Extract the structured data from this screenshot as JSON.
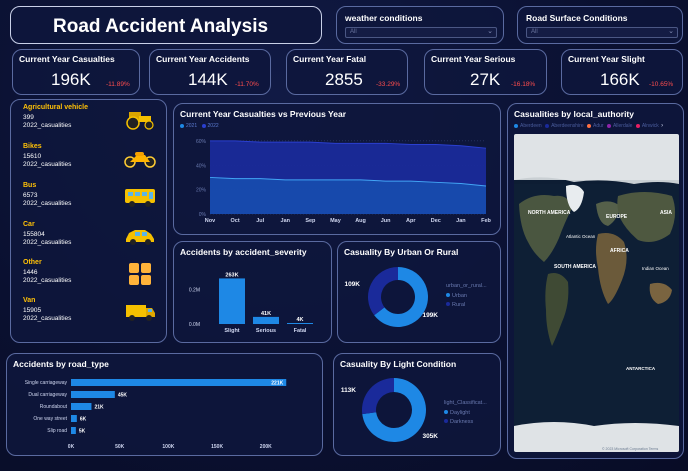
{
  "title": "Road Accident Analysis",
  "slicers": [
    {
      "label": "weather conditions",
      "value": "All"
    },
    {
      "label": "Road Surface Conditions",
      "value": "All"
    }
  ],
  "kpis": [
    {
      "label": "Current Year Casualties",
      "value": "196K",
      "change": "-11.89%"
    },
    {
      "label": "Current Year Accidents",
      "value": "144K",
      "change": "-11.70%"
    },
    {
      "label": "Current Year Fatal",
      "value": "2855",
      "change": "-33.29%"
    },
    {
      "label": "Current Year Serious",
      "value": "27K",
      "change": "-16.18%"
    },
    {
      "label": "Current Year Slight",
      "value": "166K",
      "change": "-10.65%"
    }
  ],
  "vehicles": [
    {
      "name": "Agricultural vehicle",
      "count": "399",
      "sub": "2022_casualities",
      "icon": "tractor-icon"
    },
    {
      "name": "Bikes",
      "count": "15610",
      "sub": "2022_casualities",
      "icon": "motorbike-icon"
    },
    {
      "name": "Bus",
      "count": "6573",
      "sub": "2022_casualities",
      "icon": "bus-icon"
    },
    {
      "name": "Car",
      "count": "155804",
      "sub": "2022_casualities",
      "icon": "car-icon"
    },
    {
      "name": "Other",
      "count": "1446",
      "sub": "2022_casualities",
      "icon": "grid-icon"
    },
    {
      "name": "Van",
      "count": "15905",
      "sub": "2022_casualities",
      "icon": "van-icon"
    }
  ],
  "colors": {
    "accent": "#1e88e5",
    "dark_series": "#1a2a9a",
    "negative": "#ff4d4d",
    "vehicle_label": "#ffc107"
  },
  "chart_data": [
    {
      "type": "area",
      "title": "Current Year Casualties vs Previous Year",
      "legend": [
        "2021",
        "2022"
      ],
      "x": [
        "Nov",
        "Oct",
        "Jul",
        "Jan",
        "Sep",
        "May",
        "Aug",
        "Jun",
        "Apr",
        "Dec",
        "Jan",
        "Feb"
      ],
      "y_ticks": [
        "0%",
        "20%",
        "40%",
        "60%"
      ],
      "ylim": [
        0,
        0.64
      ],
      "series": [
        {
          "name": "2021",
          "values": [
            0.6,
            0.6,
            0.59,
            0.59,
            0.59,
            0.58,
            0.58,
            0.58,
            0.57,
            0.57,
            0.56,
            0.54
          ]
        },
        {
          "name": "2022",
          "values": [
            0.3,
            0.29,
            0.29,
            0.28,
            0.28,
            0.28,
            0.28,
            0.27,
            0.27,
            0.26,
            0.25,
            0.23
          ]
        }
      ]
    },
    {
      "type": "bar",
      "title": "Accidents by accident_severity",
      "categories": [
        "Slight",
        "Serious",
        "Fatal"
      ],
      "values": [
        263000,
        41000,
        4000
      ],
      "data_labels": [
        "263K",
        "41K",
        "4K"
      ],
      "y_ticks": [
        "0.0M",
        "0.2M"
      ],
      "ylim": [
        0,
        300000
      ]
    },
    {
      "type": "pie",
      "title": "Casuality By Urban Or Rural",
      "legend_title": "urban_or_rural...",
      "categories": [
        "Urban",
        "Rural"
      ],
      "values": [
        199000,
        109000
      ],
      "data_labels": [
        "199K",
        "109K"
      ]
    },
    {
      "type": "bar",
      "title": "Accidents by road_type",
      "orientation": "horizontal",
      "categories": [
        "Single carriageway",
        "Dual carriageway",
        "Roundabout",
        "One way street",
        "Slip road"
      ],
      "values": [
        221000,
        45000,
        21000,
        6000,
        5000
      ],
      "data_labels": [
        "221K",
        "45K",
        "21K",
        "6K",
        "5K"
      ],
      "x_ticks": [
        "0K",
        "50K",
        "100K",
        "150K",
        "200K"
      ],
      "xlim": [
        0,
        230000
      ]
    },
    {
      "type": "pie",
      "title": "Casuality By Light Condition",
      "legend_title": "light_Classificat...",
      "categories": [
        "Daylight",
        "Darkness"
      ],
      "values": [
        305000,
        113000
      ],
      "data_labels": [
        "305K",
        "113K"
      ]
    }
  ],
  "map": {
    "title": "Casualities by local_authority",
    "legend": [
      "Aberdeen",
      "Aberdeenshire",
      "Adur",
      "Allerdale",
      "Alnwick"
    ],
    "labels": [
      "NORTH AMERICA",
      "EUROPE",
      "ASIA",
      "Atlantic Ocean",
      "AFRICA",
      "SOUTH AMERICA",
      "Indian Ocean",
      "ANTARCTICA"
    ],
    "footer": "© 2023 Microsoft Corporation Terms"
  }
}
